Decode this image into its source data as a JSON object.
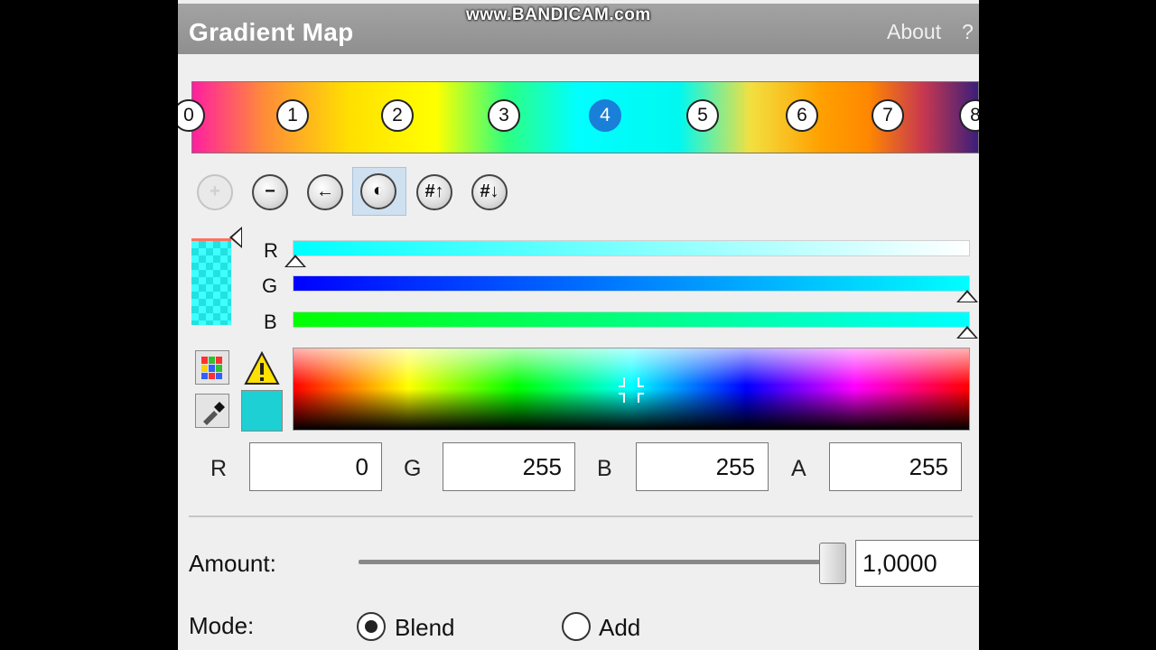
{
  "watermark": "www.BANDICAM.com",
  "header": {
    "title": "Gradient Map",
    "about": "About",
    "help": "?"
  },
  "gradient": {
    "stops": [
      "0",
      "1",
      "2",
      "3",
      "4",
      "5",
      "6",
      "7",
      "8"
    ],
    "active_stop": "4"
  },
  "toolbar": {
    "add_icon": "plus-circle-icon",
    "remove_icon": "minus-circle-icon",
    "left_icon": "arrow-left-icon",
    "mirror_icon": "mirror-icon",
    "up_icon": "hash-up-icon",
    "down_icon": "hash-down-icon"
  },
  "channels": {
    "r_label": "R",
    "g_label": "G",
    "b_label": "B"
  },
  "values": {
    "r_label": "R",
    "r_value": "0",
    "g_label": "G",
    "g_value": "255",
    "b_label": "B",
    "b_value": "255",
    "a_label": "A",
    "a_value": "255"
  },
  "amount": {
    "label": "Amount:",
    "value": "1,0000",
    "slider_fraction": 1.0
  },
  "mode": {
    "label": "Mode:",
    "blend": "Blend",
    "add": "Add",
    "selected": "Blend"
  },
  "colors": {
    "current": "#1cd0d4",
    "accent": "#1a7fd8"
  }
}
